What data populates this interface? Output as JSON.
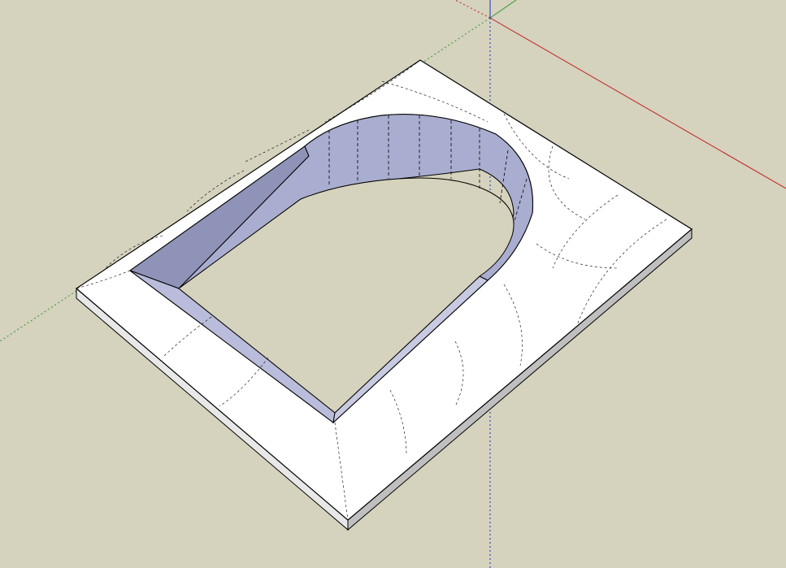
{
  "viewport": {
    "background_color": "#d5d2bd",
    "axis_colors": {
      "x": "#c02020",
      "y": "#2a9a2a",
      "z": "#2030c0"
    },
    "model": {
      "top_face_color": "#ffffff",
      "inner_wall_color": "#a9adcf",
      "inner_wall_shadow_color": "#8f93b8",
      "edge_color": "#000000"
    }
  }
}
